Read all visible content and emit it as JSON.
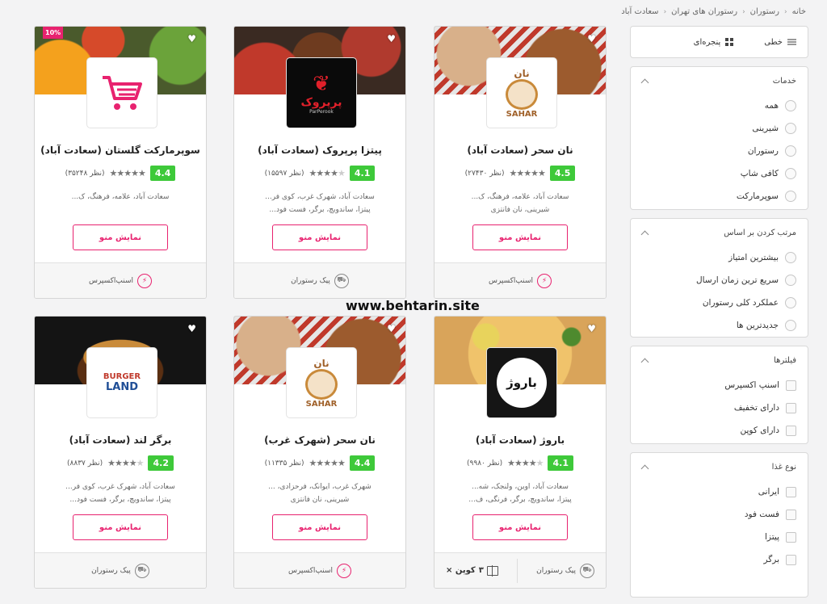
{
  "breadcrumb": [
    "خانه",
    "رستوران",
    "رستوران های تهران",
    "سعادت آباد"
  ],
  "view": {
    "list_label": "خطی",
    "grid_label": "پنجره‌ای"
  },
  "services": {
    "title": "خدمات",
    "options": [
      "همه",
      "شیرینی",
      "رستوران",
      "کافی شاپ",
      "سوپرمارکت"
    ]
  },
  "sort": {
    "title": "مرتب کردن بر اساس",
    "options": [
      "بیشترین امتیاز",
      "سریع ترین زمان ارسال",
      "عملکرد کلی رستوران",
      "جدیدترین ها"
    ]
  },
  "filters": {
    "title": "فیلترها",
    "options": [
      "اسنپ اکسپرس",
      "دارای تخفیف",
      "دارای کوپن"
    ]
  },
  "food_type": {
    "title": "نوع غذا",
    "options": [
      "ایرانی",
      "فست فود",
      "پیتزا",
      "برگر"
    ]
  },
  "watermark": "www.behtarin.site",
  "menu_button_label": "نمایش منو",
  "accent_color": "#e8226f",
  "rating_color": "#3ec93a",
  "cards": [
    {
      "name": "نان سحر (سعادت آباد)",
      "score": "4.5",
      "stars": 4.5,
      "reviews": "(۲۷۴۳۰ نظر)",
      "desc1": "سعادت آباد، علامه، فرهنگ، ک...",
      "desc2": "شیرینی، نان فانتزی",
      "delivery": "اسنپ‌اکسپرس",
      "delivery_icon": "snapp-express-icon",
      "logo": "sahar",
      "logo_top": "نان",
      "logo_bottom": "SAHAR",
      "hero": "h-bread"
    },
    {
      "name": "پیتزا پرپروک (سعادت آباد)",
      "score": "4.1",
      "stars": 4,
      "reviews": "(۱۵۵۹۷ نظر)",
      "desc1": "سعادت آباد، شهرک غرب، کوی فر...",
      "desc2": "پیتزا، ساندویچ، برگر، فست فود...",
      "delivery": "پیک رستوران",
      "delivery_icon": "restaurant-courier-icon",
      "logo": "parperook",
      "logo_text": "پرپروک",
      "logo_sub": "ParPerook",
      "hero": "h-pizza-dark"
    },
    {
      "name": "سوپرمارکت گلستان (سعادت آباد)",
      "score": "4.4",
      "stars": 4.5,
      "reviews": "(۳۵۲۴۸ نظر)",
      "desc1": "سعادت آباد، علامه، فرهنگ، ک...",
      "desc2": "",
      "delivery": "اسنپ‌اکسپرس",
      "delivery_icon": "snapp-express-icon",
      "logo": "cart",
      "discount": "10%",
      "hero": "h-veg"
    },
    {
      "name": "باروژ (سعادت آباد)",
      "score": "4.1",
      "stars": 4,
      "reviews": "(۹۹۸۰ نظر)",
      "desc1": "سعادت آباد، اوین، ولنجک، شه...",
      "desc2": "پیتزا، ساندویچ، برگر، فرنگی، ف...",
      "delivery": "پیک رستوران",
      "delivery_icon": "restaurant-courier-icon",
      "logo": "barooj",
      "logo_text": "باروژ",
      "coupon": "× کوپن",
      "coupon_count": "۳",
      "hero": "h-pizza-light"
    },
    {
      "name": "نان سحر (شهرک غرب)",
      "score": "4.4",
      "stars": 4.5,
      "reviews": "(۱۱۳۳۵ نظر)",
      "desc1": "شهرک غرب، ایوانک، فرحزادی، ...",
      "desc2": "شیرینی، نان فانتزی",
      "delivery": "اسنپ‌اکسپرس",
      "delivery_icon": "snapp-express-icon",
      "logo": "sahar",
      "logo_top": "نان",
      "logo_bottom": "SAHAR",
      "hero": "h-bread"
    },
    {
      "name": "برگر لند (سعادت آباد)",
      "score": "4.2",
      "stars": 4,
      "reviews": "(۸۸۳۷ نظر)",
      "desc1": "سعادت آباد، شهرک غرب، کوی فر...",
      "desc2": "پیتزا، ساندویچ، برگر، فست فود...",
      "delivery": "پیک رستوران",
      "delivery_icon": "restaurant-courier-icon",
      "logo": "burgerland",
      "logo_text": "BURGER",
      "logo_sub": "LAND",
      "hero": "h-burger"
    }
  ]
}
